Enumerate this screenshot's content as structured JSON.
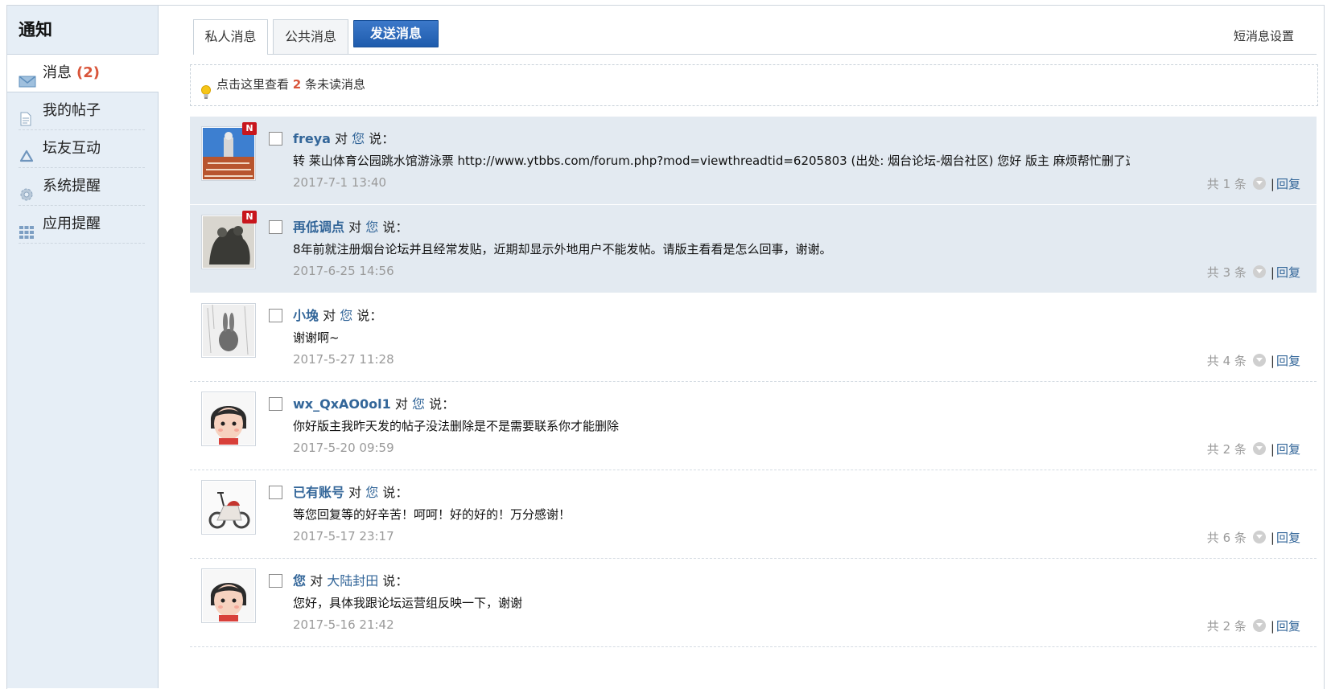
{
  "sidebar": {
    "title": "通知",
    "items": [
      {
        "label": "消息",
        "count": "(2)",
        "icon": "envelope-icon"
      },
      {
        "label": "我的帖子",
        "icon": "document-icon"
      },
      {
        "label": "坛友互动",
        "icon": "recycle-icon"
      },
      {
        "label": "系统提醒",
        "icon": "gear-icon"
      },
      {
        "label": "应用提醒",
        "icon": "grid-icon"
      }
    ]
  },
  "tabs": {
    "private": "私人消息",
    "public": "公共消息",
    "send": "发送消息",
    "settings": "短消息设置"
  },
  "notice": {
    "prefix": "点击这里查看",
    "count": "2",
    "suffix": "条未读消息"
  },
  "labels": {
    "to": "对",
    "says": "说：",
    "total_prefix": "共",
    "total_suffix": "条",
    "separator": "|",
    "reply": "回复"
  },
  "messages": [
    {
      "from": "freya",
      "to": "您",
      "text": "转 莱山体育公园跳水馆游泳票 http://www.ytbbs.com/forum.php?mod=viewthreadtid=6205803 (出处: 烟台论坛-烟台社区) 您好 版主 麻烦帮忙删了这个帖子吧 因 ...",
      "date": "2017-7-1 13:40",
      "count": "1",
      "unread": true,
      "badge": "N"
    },
    {
      "from": "再低调点",
      "to": "您",
      "text": "8年前就注册烟台论坛并且经常发贴，近期却显示外地用户不能发帖。请版主看看是怎么回事，谢谢。",
      "date": "2017-6-25 14:56",
      "count": "3",
      "unread": true,
      "badge": "N"
    },
    {
      "from": "小堍",
      "to": "您",
      "text": "谢谢啊~",
      "date": "2017-5-27 11:28",
      "count": "4",
      "unread": false
    },
    {
      "from": "wx_QxAO0ol1",
      "to": "您",
      "text": "你好版主我昨天发的帖子没法删除是不是需要联系你才能删除",
      "date": "2017-5-20 09:59",
      "count": "2",
      "unread": false
    },
    {
      "from": "已有账号",
      "to": "您",
      "text": "等您回复等的好辛苦！呵呵！好的好的！万分感谢！",
      "date": "2017-5-17 23:17",
      "count": "6",
      "unread": false
    },
    {
      "from": "您",
      "to": "大陆封田",
      "text": "您好，具体我跟论坛运营组反映一下，谢谢",
      "date": "2017-5-16 21:42",
      "count": "2",
      "unread": false
    }
  ]
}
